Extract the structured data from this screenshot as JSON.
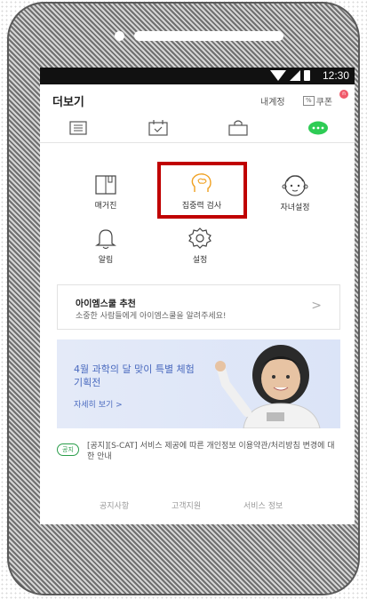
{
  "statusbar": {
    "time": "12:30"
  },
  "header": {
    "title": "더보기",
    "account": "내계정",
    "coupon_tag": "%",
    "coupon": "쿠폰",
    "badge": "n"
  },
  "tabs": [
    {
      "icon": "list-icon"
    },
    {
      "icon": "calendar-check-icon"
    },
    {
      "icon": "shopping-bag-icon"
    },
    {
      "icon": "more-dots-icon",
      "active_color": "#2ecc55"
    }
  ],
  "grid": {
    "magazine": "매거진",
    "focus_test": "집중력 검사",
    "child_settings": "자녀설정",
    "alarm": "알림",
    "settings": "설정"
  },
  "highlight_color": "#c00000",
  "recommend": {
    "title": "아이엠스쿨 추천",
    "subtitle": "소중한 사람들에게 아이엠스쿨을 알려주세요!",
    "arrow": ">"
  },
  "banner": {
    "title": "4월 과학의 달 맞이 특별 체험 기획전",
    "link": "자세히 보기 >"
  },
  "notice": {
    "badge": "공지",
    "text": "[공지][S-CAT] 서비스 제공에 따른 개인정보 이용약관/처리방침 변경에 대한 안내"
  },
  "footer": {
    "notice": "공지사항",
    "support": "고객지원",
    "service_info": "서비스 정보"
  }
}
